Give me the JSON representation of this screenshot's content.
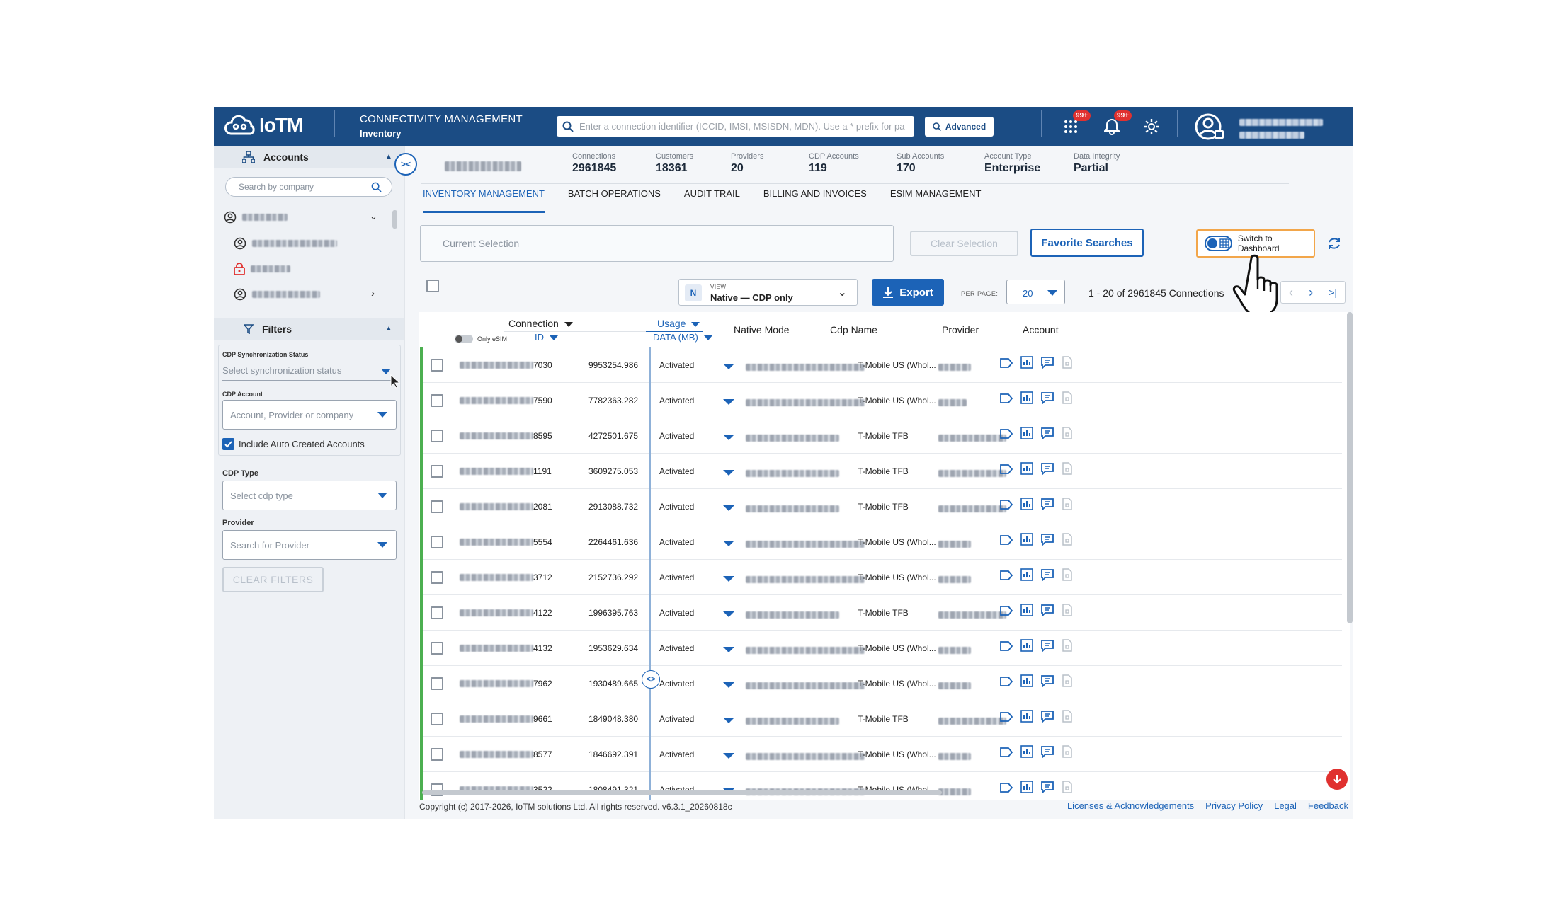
{
  "header": {
    "logo_text": "IoTM",
    "app_title": "CONNECTIVITY MANAGEMENT",
    "app_subtitle": "Inventory",
    "search_placeholder": "Enter a connection identifier (ICCID, IMSI, MSISDN, MDN). Use a * prefix for partial search",
    "advanced_label": "Advanced",
    "apps_badge": "99+",
    "notifications_badge": "99+"
  },
  "sidebar": {
    "accounts_label": "Accounts",
    "company_search_placeholder": "Search by company",
    "filters_label": "Filters",
    "cdp_sync_label": "CDP Synchronization Status",
    "cdp_sync_placeholder": "Select synchronization status",
    "cdp_account_label": "CDP Account",
    "cdp_account_placeholder": "Account, Provider or company",
    "include_auto_label": "Include Auto Created Accounts",
    "cdp_type_label": "CDP Type",
    "cdp_type_placeholder": "Select cdp type",
    "provider_label": "Provider",
    "provider_placeholder": "Search for Provider",
    "clear_filters_label": "CLEAR FILTERS"
  },
  "stats": [
    {
      "label": "Connections",
      "value": "2961845"
    },
    {
      "label": "Customers",
      "value": "18361"
    },
    {
      "label": "Providers",
      "value": "20"
    },
    {
      "label": "CDP Accounts",
      "value": "119"
    },
    {
      "label": "Sub Accounts",
      "value": "170"
    },
    {
      "label": "Account Type",
      "value": "Enterprise"
    },
    {
      "label": "Data Integrity",
      "value": "Partial"
    }
  ],
  "tabs": [
    "INVENTORY MANAGEMENT",
    "BATCH OPERATIONS",
    "AUDIT TRAIL",
    "BILLING AND INVOICES",
    "ESIM MANAGEMENT"
  ],
  "toolbar": {
    "current_selection_placeholder": "Current Selection",
    "clear_selection_label": "Clear Selection",
    "favorite_searches_label": "Favorite Searches",
    "switch_dashboard_label": "Switch to Dashboard",
    "view_badge": "N",
    "view_label": "VIEW",
    "view_value": "Native — CDP only",
    "export_label": "Export",
    "per_page_label": "PER PAGE:",
    "per_page_value": "20",
    "pagination_info": "1 - 20 of 2961845 Connections"
  },
  "table": {
    "col_connection": "Connection",
    "only_esim_label": "Only eSIM",
    "col_id": "ID",
    "col_usage": "Usage",
    "col_data_mb": "DATA (MB)",
    "col_native_mode": "Native Mode",
    "col_cdp_name": "Cdp Name",
    "col_provider": "Provider",
    "col_account": "Account",
    "rows": [
      {
        "id_suffix": "7030",
        "usage": "9953254.986",
        "mode": "Activated",
        "provider": "T-Mobile US (Whol..."
      },
      {
        "id_suffix": "7590",
        "usage": "7782363.282",
        "mode": "Activated",
        "provider": "T-Mobile US (Whol..."
      },
      {
        "id_suffix": "8595",
        "usage": "4272501.675",
        "mode": "Activated",
        "provider": "T-Mobile TFB"
      },
      {
        "id_suffix": "1191",
        "usage": "3609275.053",
        "mode": "Activated",
        "provider": "T-Mobile TFB"
      },
      {
        "id_suffix": "2081",
        "usage": "2913088.732",
        "mode": "Activated",
        "provider": "T-Mobile TFB"
      },
      {
        "id_suffix": "5554",
        "usage": "2264461.636",
        "mode": "Activated",
        "provider": "T-Mobile US (Whol..."
      },
      {
        "id_suffix": "3712",
        "usage": "2152736.292",
        "mode": "Activated",
        "provider": "T-Mobile US (Whol..."
      },
      {
        "id_suffix": "4122",
        "usage": "1996395.763",
        "mode": "Activated",
        "provider": "T-Mobile TFB"
      },
      {
        "id_suffix": "4132",
        "usage": "1953629.634",
        "mode": "Activated",
        "provider": "T-Mobile US (Whol..."
      },
      {
        "id_suffix": "7962",
        "usage": "1930489.665",
        "mode": "Activated",
        "provider": "T-Mobile US (Whol..."
      },
      {
        "id_suffix": "9661",
        "usage": "1849048.380",
        "mode": "Activated",
        "provider": "T-Mobile TFB"
      },
      {
        "id_suffix": "8577",
        "usage": "1846692.391",
        "mode": "Activated",
        "provider": "T-Mobile US (Whol..."
      },
      {
        "id_suffix": "3522",
        "usage": "1808491.321",
        "mode": "Activated",
        "provider": "T-Mobile US (Whol..."
      }
    ]
  },
  "footer": {
    "copyright": "Copyright (c) 2017-2026, IoTM solutions Ltd. All rights reserved. v6.3.1_20260818c",
    "links": [
      "Licenses & Acknowledgements",
      "Privacy Policy",
      "Legal",
      "Feedback"
    ]
  },
  "colors": {
    "header_bg": "#1b4c84",
    "accent": "#1c63b7",
    "highlight": "#f2a64a",
    "row_indicator": "#4caf50",
    "badge": "#e0312f"
  }
}
